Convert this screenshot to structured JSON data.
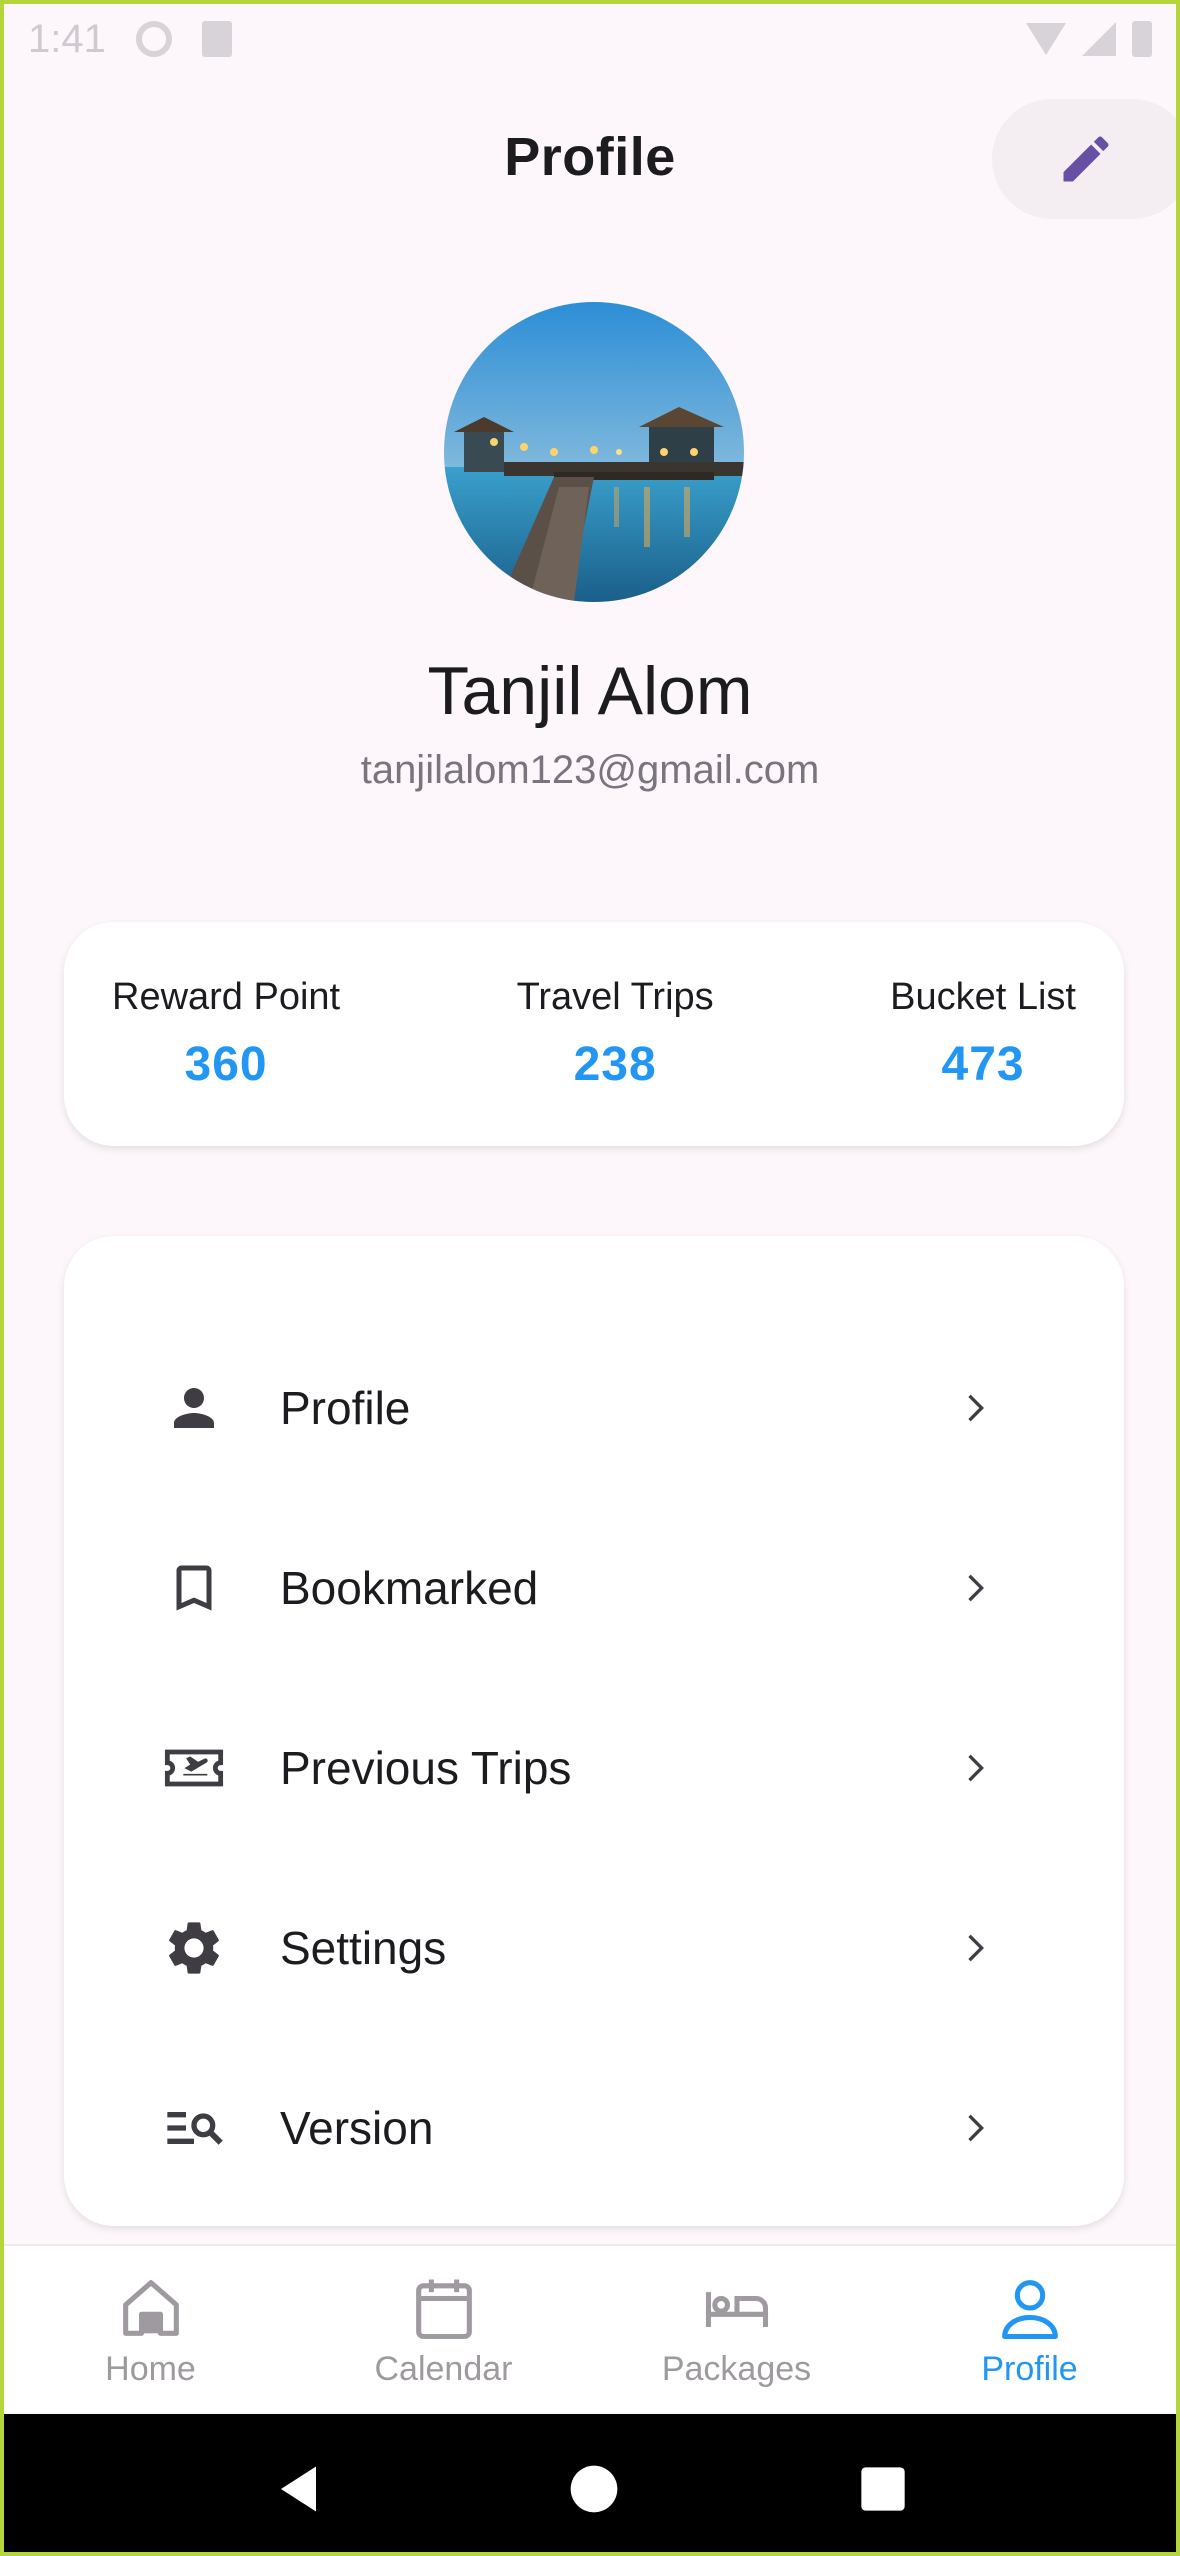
{
  "status_bar": {
    "time": "1:41"
  },
  "header": {
    "title": "Profile",
    "edit_icon": "pencil-icon"
  },
  "user": {
    "name": "Tanjil Alom",
    "email": "tanjilalom123@gmail.com",
    "avatar": "pier-at-dusk-photo"
  },
  "stats": [
    {
      "label": "Reward Point",
      "value": "360"
    },
    {
      "label": "Travel Trips",
      "value": "238"
    },
    {
      "label": "Bucket List",
      "value": "473"
    }
  ],
  "menu": [
    {
      "label": "Profile",
      "icon": "person-icon"
    },
    {
      "label": "Bookmarked",
      "icon": "bookmark-icon"
    },
    {
      "label": "Previous Trips",
      "icon": "flight-ticket-icon"
    },
    {
      "label": "Settings",
      "icon": "gear-icon"
    },
    {
      "label": "Version",
      "icon": "list-search-icon"
    }
  ],
  "bottom_nav": [
    {
      "label": "Home",
      "icon": "home-icon",
      "active": false
    },
    {
      "label": "Calendar",
      "icon": "calendar-icon",
      "active": false
    },
    {
      "label": "Packages",
      "icon": "bed-icon",
      "active": false
    },
    {
      "label": "Profile",
      "icon": "person-outline-icon",
      "active": true
    }
  ],
  "colors": {
    "accent": "#2196f3",
    "edit_icon": "#6750a4",
    "background": "#fdf7fb"
  }
}
